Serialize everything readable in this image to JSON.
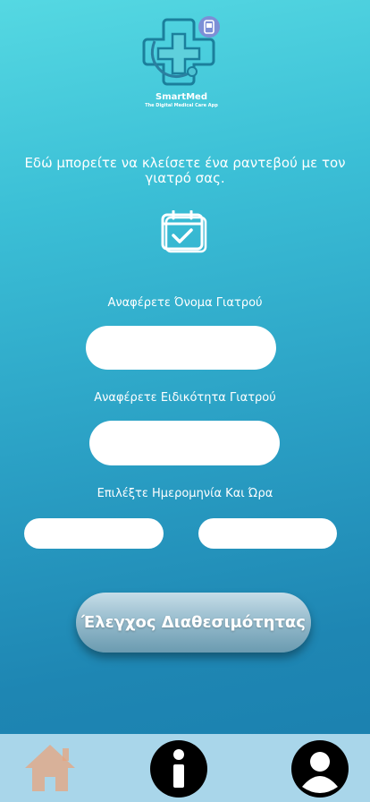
{
  "logo": {
    "title": "SmartMed",
    "subtitle": "The Digital Medical Care App"
  },
  "intro_text": "Εδώ μπορείτε να κλείσετε ένα ραντεβού με τον γιατρό σας.",
  "form": {
    "doctor_name_label": "Αναφέρετε Όνομα Γιατρού",
    "doctor_name_value": "",
    "specialty_label": "Αναφέρετε Ειδικότητα Γιατρού",
    "specialty_value": "",
    "datetime_label": "Επιλέξτε Ημερομηνία Και Ώρα",
    "date_value": "",
    "time_value": ""
  },
  "check_button_label": "Έλεγχος Διαθεσιμότητας",
  "nav": {
    "items": [
      {
        "icon": "home-icon"
      },
      {
        "icon": "info-icon"
      },
      {
        "icon": "profile-icon"
      }
    ]
  },
  "colors": {
    "gradient_top": "#55d8e2",
    "gradient_bottom": "#1a7fae",
    "nav_background": "#a9d6ea",
    "home_icon": "#e8a47e"
  }
}
